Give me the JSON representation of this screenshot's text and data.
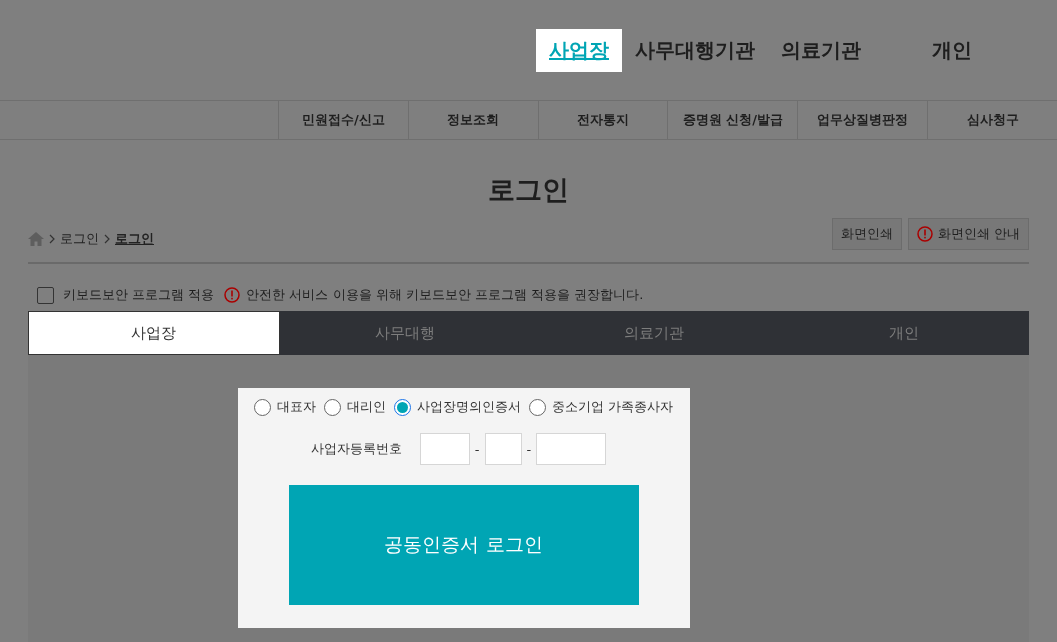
{
  "header_nav": [
    {
      "label": "사업장",
      "selected": true
    },
    {
      "label": "사무대행기관",
      "selected": false
    },
    {
      "label": "의료기관",
      "selected": false
    },
    {
      "label": "개인",
      "selected": false
    }
  ],
  "sub_nav": [
    "민원접수/신고",
    "정보조회",
    "전자통지",
    "증명원 신청/발급",
    "업무상질병판정",
    "심사청구"
  ],
  "page_title": "로그인",
  "breadcrumb": [
    {
      "label": "로그인",
      "current": false
    },
    {
      "label": "로그인",
      "current": true
    }
  ],
  "print_buttons": [
    {
      "label": "화면인쇄",
      "kind": "plain"
    },
    {
      "label": "화면인쇄 안내",
      "kind": "info"
    }
  ],
  "keyboard_security": {
    "label": "키보드보안 프로그램 적용",
    "checked": false,
    "notice": "안전한 서비스 이용을 위해 키보드보안 프로그램 적용을 권장합니다."
  },
  "tabs": [
    {
      "label": "사업장",
      "selected": true
    },
    {
      "label": "사무대행",
      "selected": false
    },
    {
      "label": "의료기관",
      "selected": false
    },
    {
      "label": "개인",
      "selected": false
    }
  ],
  "login_types": [
    {
      "label": "대표자",
      "selected": false
    },
    {
      "label": "대리인",
      "selected": false
    },
    {
      "label": "사업장명의인증서",
      "selected": true
    },
    {
      "label": "중소기업 가족종사자",
      "selected": false
    }
  ],
  "registration": {
    "label": "사업자등록번호",
    "separators": [
      "-",
      "-"
    ]
  },
  "login_button": "공동인증서 로그인"
}
